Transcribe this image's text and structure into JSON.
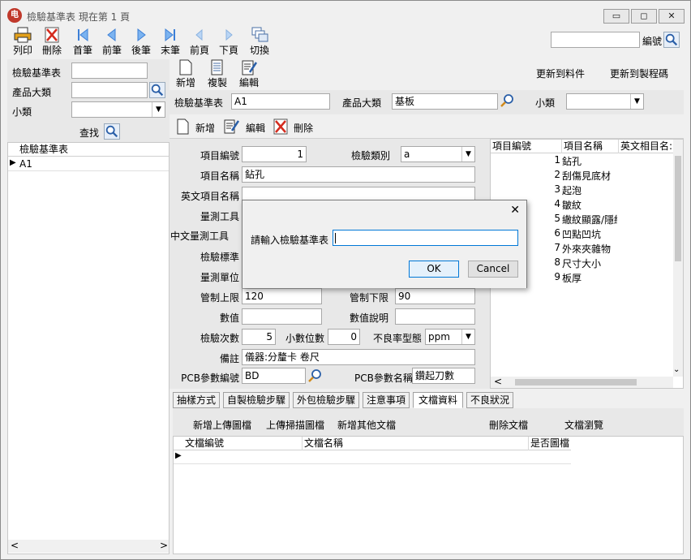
{
  "window": {
    "title": "檢驗基準表 現在第 1 頁",
    "icon_glyph": "电",
    "btn_min": "▭",
    "btn_max": "◻",
    "btn_close": "✕"
  },
  "toolbar": {
    "items": [
      {
        "label": "列印",
        "icon": "printer-icon"
      },
      {
        "label": "刪除",
        "icon": "delete-icon"
      },
      {
        "label": "首筆",
        "icon": "first-icon"
      },
      {
        "label": "前筆",
        "icon": "prev-icon"
      },
      {
        "label": "後筆",
        "icon": "next-icon"
      },
      {
        "label": "末筆",
        "icon": "last-icon"
      },
      {
        "label": "前頁",
        "icon": "prev-page-icon"
      },
      {
        "label": "下頁",
        "icon": "next-page-icon"
      },
      {
        "label": "切換",
        "icon": "switch-icon"
      }
    ],
    "search_value": "",
    "search_label": "編號"
  },
  "left": {
    "filter_table_label": "檢驗基準表",
    "filter_table_value": "",
    "product_class_label": "產品大類",
    "product_class_value": "",
    "sub_class_label": "小類",
    "sub_class_value": "",
    "find_label": "查找",
    "grid_header": "檢驗基準表",
    "rows": [
      "A1"
    ]
  },
  "header": {
    "new_label": "新增",
    "copy_label": "複製",
    "edit_label": "編輯",
    "update_material_label": "更新到料件",
    "update_process_label": "更新到製程碼",
    "table_label": "檢驗基準表",
    "table_value": "A1",
    "product_class_label": "產品大類",
    "product_class_value": "基板",
    "sub_class_label": "小類",
    "sub_class_value": ""
  },
  "item_toolbar": {
    "new_label": "新增",
    "edit_label": "編輯",
    "delete_label": "刪除"
  },
  "form": {
    "item_no_label": "項目編號",
    "item_no_value": "1",
    "category_label": "檢驗類別",
    "category_value": "a",
    "item_name_label": "項目名稱",
    "item_name_value": "鉆孔",
    "en_name_label": "英文項目名稱",
    "en_name_value": "",
    "tool_label": "量測工具",
    "cn_tool_label": "中文量測工具",
    "standard_label": "檢驗標準",
    "unit_label": "量測單位",
    "upper_label": "管制上限",
    "upper_value": "120",
    "lower_label": "管制下限",
    "lower_value": "90",
    "value_label": "數值",
    "value_value": "",
    "value_desc_label": "數值說明",
    "value_desc_value": "",
    "count_label": "檢驗次數",
    "count_value": "5",
    "decimal_label": "小數位數",
    "decimal_value": "0",
    "defect_label": "不良率型態",
    "defect_value": "ppm",
    "note_label": "備註",
    "note_value": "儀器:分釐卡 卷尺",
    "pcb_no_label": "PCB參數編號",
    "pcb_no_value": "BD",
    "pcb_name_label": "PCB參數名稱",
    "pcb_name_value": "鑽起刀數"
  },
  "items_grid": {
    "headers": [
      "項目編號",
      "項目名稱",
      "英文相目名:"
    ],
    "rows": [
      {
        "no": "1",
        "name": "鉆孔"
      },
      {
        "no": "2",
        "name": "刮傷見底材"
      },
      {
        "no": "3",
        "name": "起泡"
      },
      {
        "no": "4",
        "name": "皺紋"
      },
      {
        "no": "5",
        "name": "繖紋顯露/隱紋"
      },
      {
        "no": "6",
        "name": "凹點凹坑"
      },
      {
        "no": "7",
        "name": "外來夾雜物"
      },
      {
        "no": "8",
        "name": "尺寸大小"
      },
      {
        "no": "9",
        "name": "板厚"
      }
    ]
  },
  "tabs": [
    "抽樣方式",
    "自製檢驗步驟",
    "外包檢驗步驟",
    "注意事項",
    "文檔資料",
    "不良狀況"
  ],
  "docs": {
    "add_upload_label": "新增上傳圖檔",
    "upload_scan_label": "上傳掃描圖檔",
    "add_other_label": "新增其他文檔",
    "delete_label": "刪除文檔",
    "browse_label": "文檔瀏覽",
    "headers": [
      "文檔編號",
      "文檔名稱",
      "是否圖檔"
    ]
  },
  "dialog": {
    "prompt": "請輸入檢驗基準表",
    "input_value": "",
    "ok_label": "OK",
    "cancel_label": "Cancel",
    "close_glyph": "✕"
  }
}
